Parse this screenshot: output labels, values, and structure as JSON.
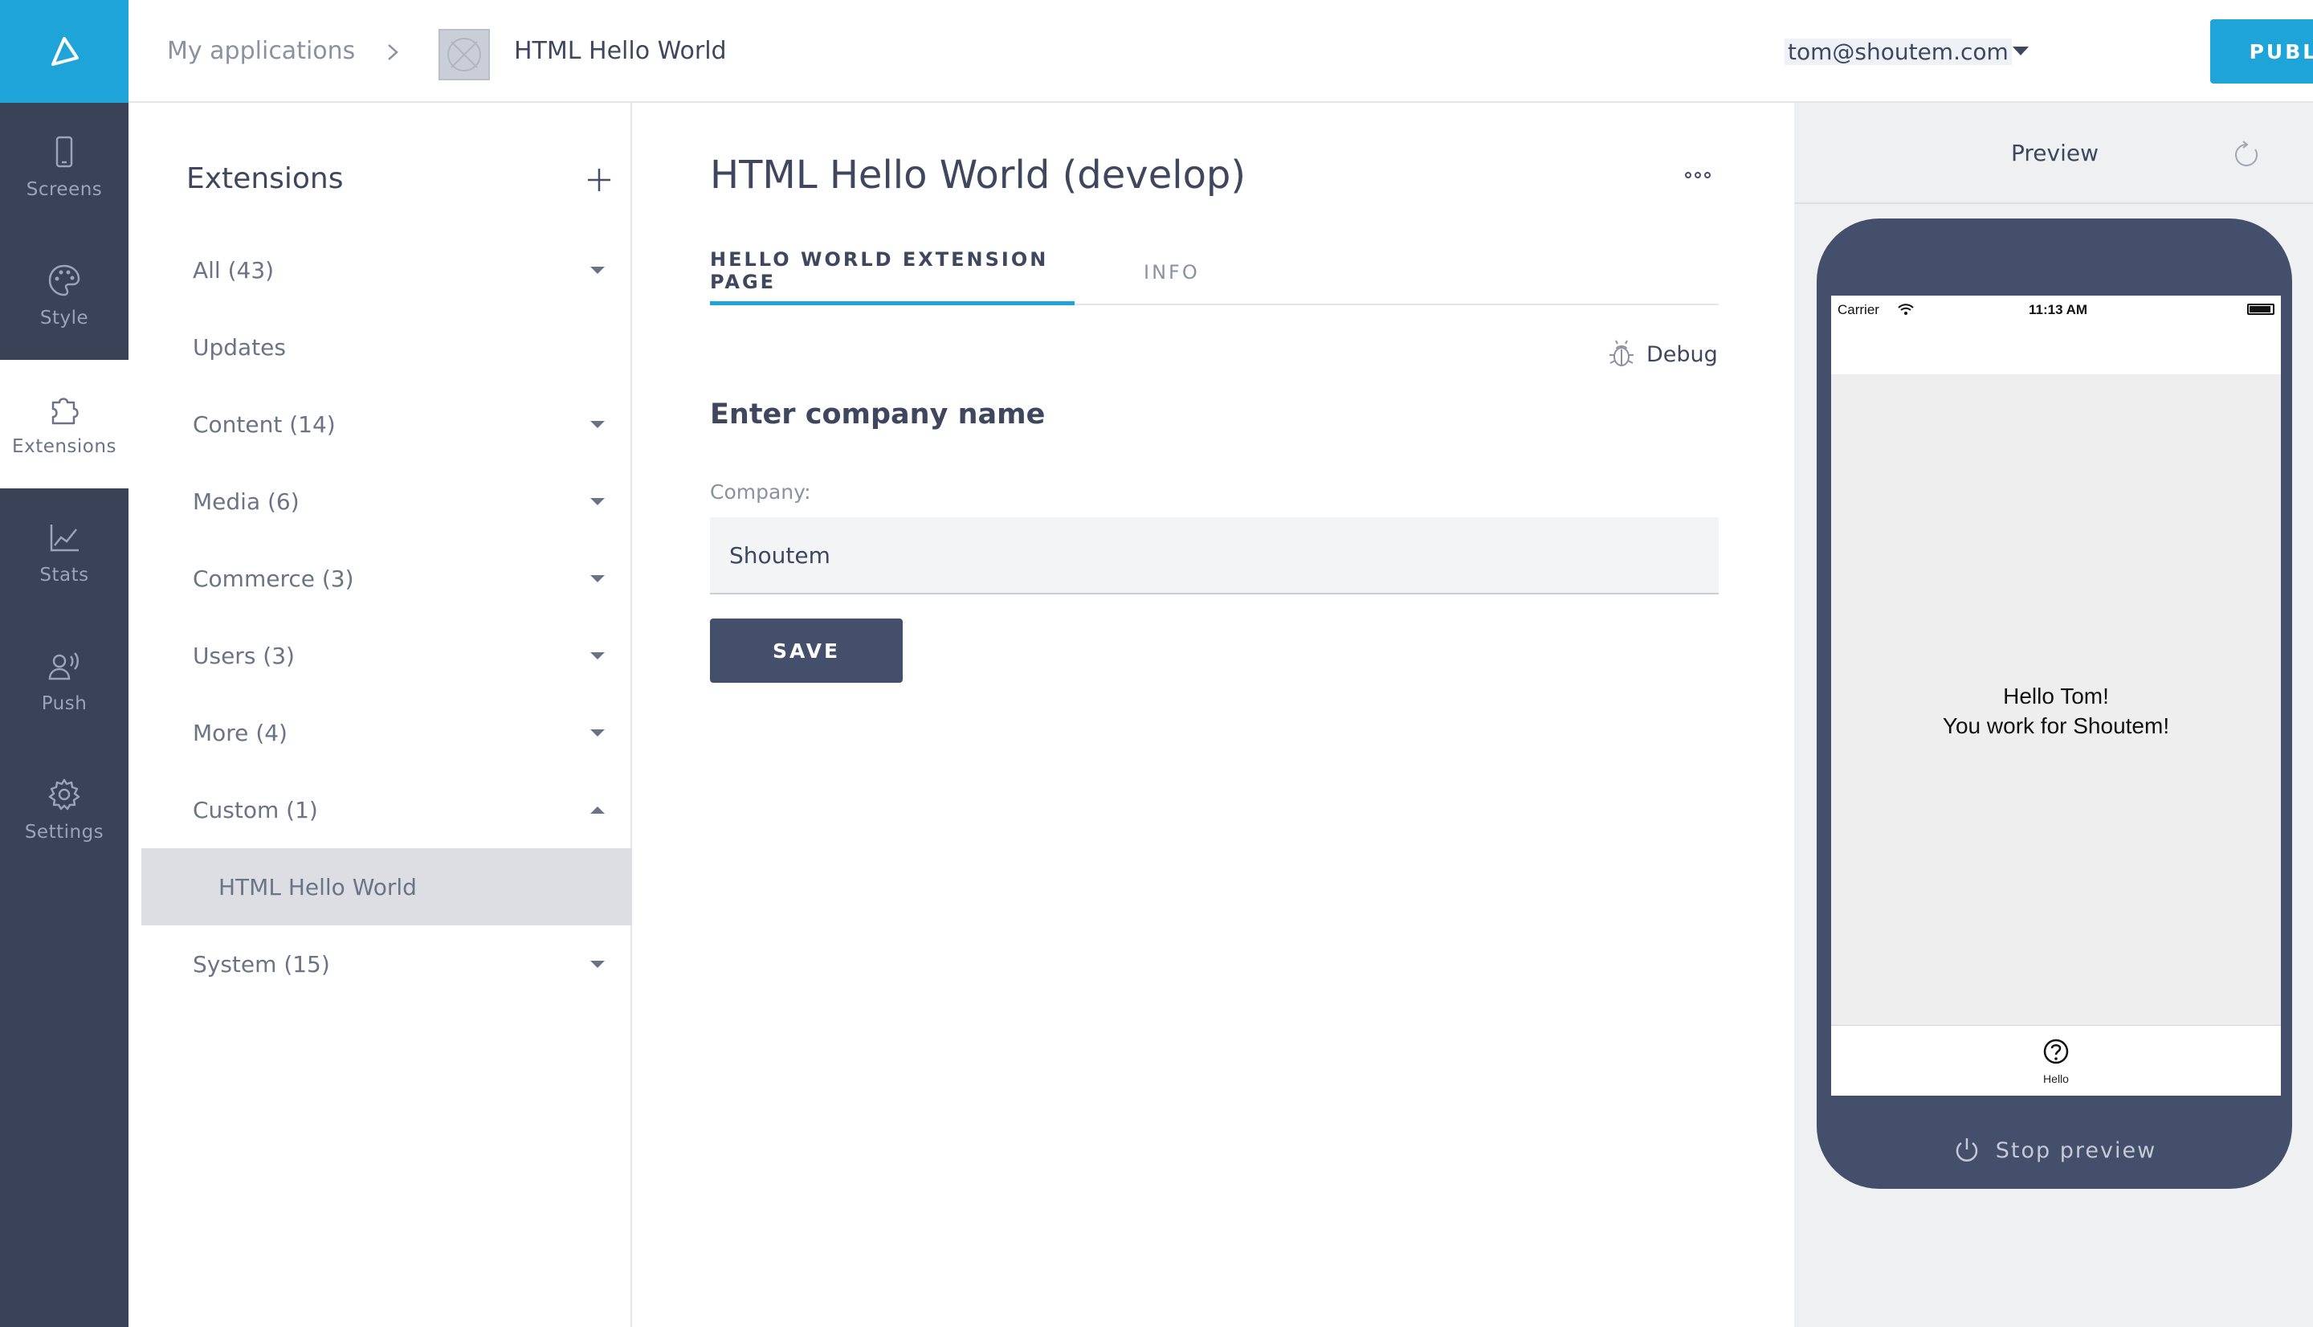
{
  "rail": {
    "items": [
      {
        "label": "Screens",
        "icon": "phone-icon"
      },
      {
        "label": "Style",
        "icon": "palette-icon"
      },
      {
        "label": "Extensions",
        "icon": "puzzle-icon",
        "active": true
      },
      {
        "label": "Stats",
        "icon": "chart-icon"
      },
      {
        "label": "Push",
        "icon": "push-icon"
      },
      {
        "label": "Settings",
        "icon": "gear-icon"
      }
    ]
  },
  "header": {
    "breadcrumb_root": "My applications",
    "breadcrumb_app": "HTML Hello World",
    "user_email": "tom@shoutem.com",
    "publish_label": "PUBLISH"
  },
  "extensions": {
    "title": "Extensions",
    "items": [
      {
        "label": "All (43)",
        "caret": "down"
      },
      {
        "label": "Updates",
        "caret": "none"
      },
      {
        "label": "Content (14)",
        "caret": "down"
      },
      {
        "label": "Media (6)",
        "caret": "down"
      },
      {
        "label": "Commerce (3)",
        "caret": "down"
      },
      {
        "label": "Users (3)",
        "caret": "down"
      },
      {
        "label": "More (4)",
        "caret": "down"
      },
      {
        "label": "Custom (1)",
        "caret": "up"
      },
      {
        "label": "HTML Hello World",
        "caret": "none",
        "selected": true
      },
      {
        "label": "System (15)",
        "caret": "down"
      }
    ]
  },
  "main": {
    "title": "HTML Hello World (develop)",
    "tabs": [
      {
        "label": "HELLO WORLD EXTENSION PAGE",
        "active": true
      },
      {
        "label": "INFO",
        "active": false
      }
    ],
    "debug_label": "Debug",
    "section_title": "Enter company name",
    "company_label": "Company:",
    "company_value": "Shoutem",
    "save_label": "SAVE"
  },
  "preview": {
    "title": "Preview",
    "status_carrier": "Carrier",
    "status_time": "11:13 AM",
    "hello_line1": "Hello Tom!",
    "hello_line2": "You work for Shoutem!",
    "tab_label": "Hello",
    "stop_label": "Stop preview"
  },
  "colors": {
    "accent": "#1fa4da",
    "rail": "#3a4257",
    "dark_button": "#444f6c"
  }
}
